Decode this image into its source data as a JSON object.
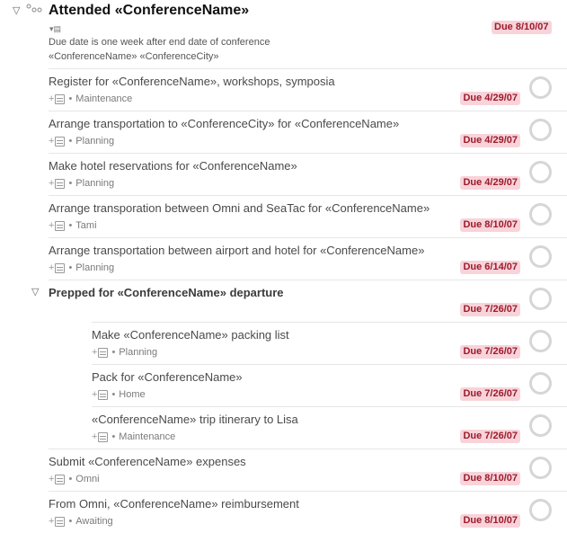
{
  "project": {
    "disclosure": "▽",
    "icon": "project-sequential-icon",
    "title": "Attended «ConferenceName»",
    "note_toggle": "▾▤",
    "note_line1": "Due date is one week after end date of conference",
    "note_line2": "«ConferenceName» «ConferenceCity»",
    "due": "Due 8/10/07"
  },
  "tasks": [
    {
      "title": "Register for «ConferenceName», workshops, symposia",
      "context": "Maintenance",
      "due": "Due 4/29/07"
    },
    {
      "title": "Arrange transportation to «ConferenceCity» for «ConferenceName»",
      "context": "Planning",
      "due": "Due 4/29/07"
    },
    {
      "title": "Make hotel reservations for «ConferenceName»",
      "context": "Planning",
      "due": "Due 4/29/07"
    },
    {
      "title": "Arrange transporation between Omni and SeaTac for «ConferenceName»",
      "context": "Tami",
      "due": "Due 8/10/07"
    },
    {
      "title": "Arrange transportation between airport and hotel for «ConferenceName»",
      "context": "Planning",
      "due": "Due 6/14/07"
    }
  ],
  "group": {
    "disclosure": "▽",
    "title": "Prepped for «ConferenceName» departure",
    "due": "Due 7/26/07",
    "subtasks": [
      {
        "title": "Make «ConferenceName» packing list",
        "context": "Planning",
        "due": "Due 7/26/07"
      },
      {
        "title": "Pack for «ConferenceName»",
        "context": "Home",
        "due": "Due 7/26/07"
      },
      {
        "title": "«ConferenceName» trip itinerary to Lisa",
        "context": "Maintenance",
        "due": "Due 7/26/07"
      }
    ]
  },
  "tail_tasks": [
    {
      "title": "Submit «ConferenceName» expenses",
      "context": "Omni",
      "due": "Due 8/10/07"
    },
    {
      "title": "From Omni, «ConferenceName» reimbursement",
      "context": "Awaiting",
      "due": "Due 8/10/07"
    }
  ],
  "meta_plus": "+",
  "meta_dot": "•",
  "colors": {
    "due_bg": "#f8d3da",
    "due_text": "#9b1b2a",
    "checkbox": "#d6d6d6"
  }
}
